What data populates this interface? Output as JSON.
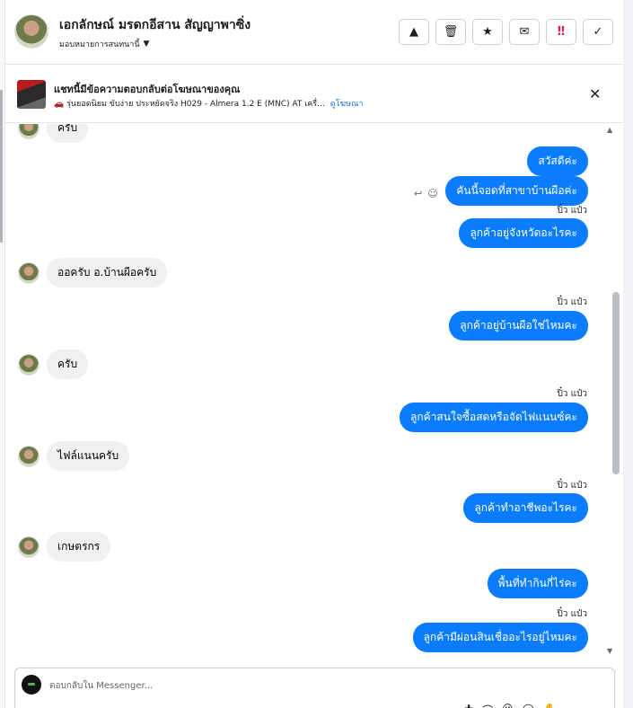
{
  "header": {
    "contact_name": "เอกลักษณ์ มรดกอีสาน สัญญาพาซิ่ง",
    "assign_label": "มอบหมายการสนทนานี้",
    "actions": [
      {
        "name": "warning-button",
        "glyph": "▲"
      },
      {
        "name": "delete-button",
        "glyph": "🗑"
      },
      {
        "name": "star-button",
        "glyph": "★"
      },
      {
        "name": "mark-unread-button",
        "glyph": "✉"
      },
      {
        "name": "follow-up-button",
        "glyph": "‼"
      },
      {
        "name": "mark-done-button",
        "glyph": "✓"
      }
    ]
  },
  "banner": {
    "title": "แชทนี้มีข้อความตอบกลับต่อโฆษณาของคุณ",
    "subtitle": "🚗 รุ่นยอดนิยม ขับง่าย ประหยัดจริง H029 - Almera 1.2 E (MNC) AT เครื่...",
    "link_label": "ดูโฆษณา",
    "close_glyph": "✕"
  },
  "chat": {
    "messages": [
      {
        "dir": "in",
        "text": "ครับ"
      },
      {
        "dir": "out",
        "text": "สวัสดีค่ะ"
      },
      {
        "dir": "out",
        "text": "คันนี้จอดที่สาขาบ้านผือค่ะ"
      },
      {
        "dir": "seen",
        "text": "ปิ๋ว แป๋ว"
      },
      {
        "dir": "out",
        "text": "ลูกค้าอยู่จังหวัดอะไรคะ"
      },
      {
        "dir": "in",
        "text": "ออครับ อ.บ้านผือครับ"
      },
      {
        "dir": "seen",
        "text": "ปิ๋ว แป๋ว"
      },
      {
        "dir": "out",
        "text": "ลูกค้าอยู่บ้านผือใช่ไหมคะ"
      },
      {
        "dir": "in",
        "text": "ครับ"
      },
      {
        "dir": "seen",
        "text": "ปิ๋ว แป๋ว"
      },
      {
        "dir": "out",
        "text": "ลูกค้าสนใจซื้อสดหรือจัดไฟแนนซ์คะ"
      },
      {
        "dir": "in",
        "text": "ไฟล์แนนครับ"
      },
      {
        "dir": "seen",
        "text": "ปิ๋ว แป๋ว"
      },
      {
        "dir": "out",
        "text": "ลูกค้าทำอาชีพอะไรคะ"
      },
      {
        "dir": "in",
        "text": "เกษตรกร"
      },
      {
        "dir": "out",
        "text": "พื้นที่ทำกินกี่ไร่คะ"
      },
      {
        "dir": "seen",
        "text": "ปิ๋ว แป๋ว"
      },
      {
        "dir": "out",
        "text": "ลูกค้ามีผ่อนสินเชื่ออะไรอยู่ไหมคะ"
      }
    ]
  },
  "composer": {
    "placeholder": "ตอบกลับใน Messenger..."
  }
}
